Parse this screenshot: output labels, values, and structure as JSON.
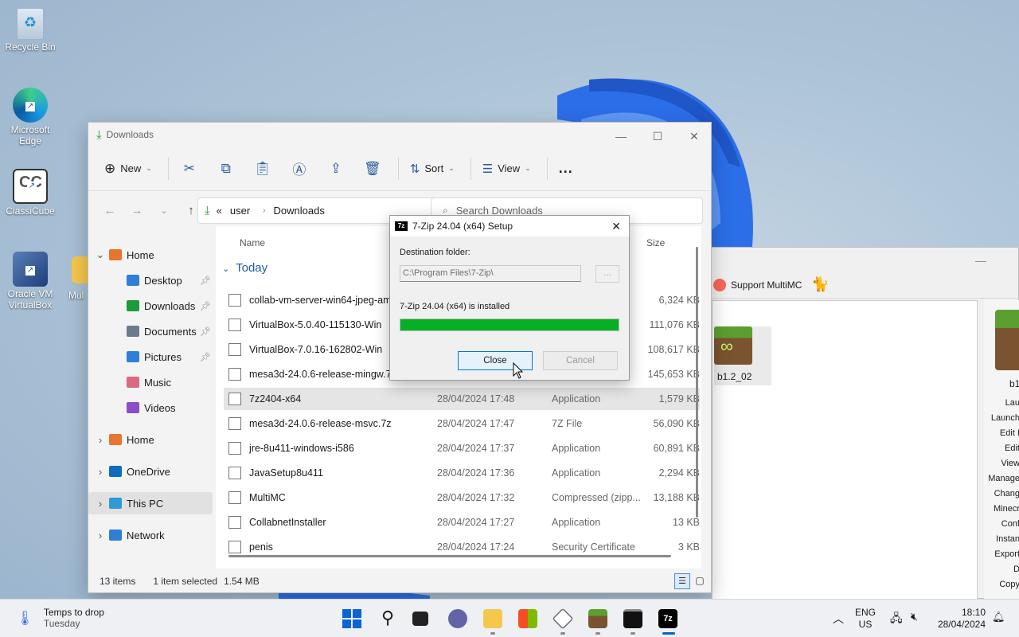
{
  "desktop": {
    "icons": [
      {
        "label": "Recycle Bin"
      },
      {
        "label": "Microsoft Edge"
      },
      {
        "label": "ClassiCube"
      },
      {
        "label": "Oracle VM VirtualBox"
      },
      {
        "label": "Mul"
      }
    ]
  },
  "explorer": {
    "title": "Downloads",
    "toolbar": {
      "new_label": "New",
      "sort_label": "Sort",
      "view_label": "View",
      "more_label": "..."
    },
    "address": {
      "prefix": "«",
      "crumb1": "user",
      "crumb2": "Downloads"
    },
    "search_placeholder": "Search Downloads",
    "sidebar": [
      {
        "label": "Home",
        "pinned": false,
        "expanded": true
      },
      {
        "label": "Desktop",
        "pinned": true
      },
      {
        "label": "Downloads",
        "pinned": true
      },
      {
        "label": "Documents",
        "pinned": true
      },
      {
        "label": "Pictures",
        "pinned": true
      },
      {
        "label": "Music",
        "pinned": false
      },
      {
        "label": "Videos",
        "pinned": false
      },
      {
        "label": "Home",
        "pinned": false
      },
      {
        "label": "OneDrive",
        "pinned": false
      },
      {
        "label": "This PC",
        "pinned": false
      },
      {
        "label": "Network",
        "pinned": false
      }
    ],
    "columns": {
      "name": "Name",
      "size": "Size"
    },
    "group_label": "Today",
    "files": [
      {
        "name": "collab-vm-server-win64-jpeg-amd",
        "date": "",
        "type": "",
        "size": "6,324 KB"
      },
      {
        "name": "VirtualBox-5.0.40-115130-Win",
        "date": "",
        "type": "",
        "size": "111,076 KB"
      },
      {
        "name": "VirtualBox-7.0.16-162802-Win",
        "date": "",
        "type": "",
        "size": "108,617 KB"
      },
      {
        "name": "mesa3d-24.0.6-release-mingw.7z",
        "date": "",
        "type": "",
        "size": "145,653 KB"
      },
      {
        "name": "7z2404-x64",
        "date": "28/04/2024 17:48",
        "type": "Application",
        "size": "1,579 KB",
        "selected": true
      },
      {
        "name": "mesa3d-24.0.6-release-msvc.7z",
        "date": "28/04/2024 17:47",
        "type": "7Z File",
        "size": "56,090 KB"
      },
      {
        "name": "jre-8u411-windows-i586",
        "date": "28/04/2024 17:37",
        "type": "Application",
        "size": "60,891 KB"
      },
      {
        "name": "JavaSetup8u411",
        "date": "28/04/2024 17:36",
        "type": "Application",
        "size": "2,294 KB"
      },
      {
        "name": "MultiMC",
        "date": "28/04/2024 17:32",
        "type": "Compressed (zipp...",
        "size": "13,188 KB"
      },
      {
        "name": "CollabnetInstaller",
        "date": "28/04/2024 17:27",
        "type": "Application",
        "size": "13 KB"
      },
      {
        "name": "penis",
        "date": "28/04/2024 17:24",
        "type": "Security Certificate",
        "size": "3 KB"
      }
    ],
    "status": {
      "items": "13 items",
      "selected": "1 item selected",
      "size": "1.54 MB"
    }
  },
  "dialog": {
    "title": "7-Zip 24.04 (x64) Setup",
    "dest_label": "Destination folder:",
    "dest_value": "C:\\Program Files\\7-Zip\\",
    "browse_label": "...",
    "installed_text": "7-Zip 24.04 (x64) is installed",
    "progress": 1.0,
    "close_label": "Close",
    "cancel_label": "Cancel"
  },
  "multimc": {
    "support_label": "Support MultiMC",
    "instance_name": "b1.2_02",
    "instance_name_right": "b1",
    "side_menu": [
      "Lau",
      "Launch",
      "Edit I",
      "Edit",
      "View",
      "Manage",
      "Chang",
      "Minecr",
      "Conf",
      "Instan",
      "Export",
      "D",
      "Copy"
    ]
  },
  "taskbar": {
    "weather_title": "Temps to drop",
    "weather_sub": "Tuesday",
    "lang_top": "ENG",
    "lang_bottom": "US",
    "time": "18:10",
    "date": "28/04/2024"
  },
  "colors": {
    "accent": "#0067c0",
    "progress": "#06b025",
    "wallpaper": "#a8c0d6"
  }
}
